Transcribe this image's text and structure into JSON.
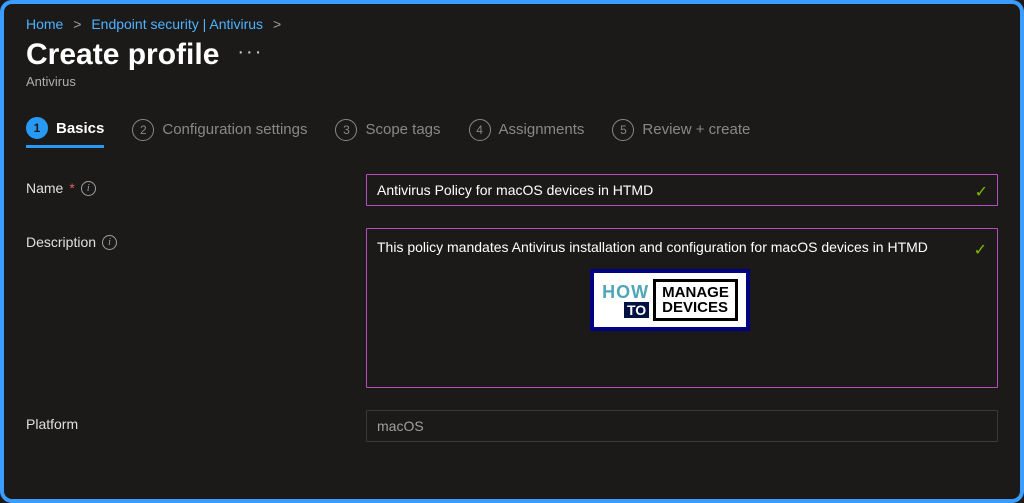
{
  "breadcrumb": {
    "home": "Home",
    "section": "Endpoint security | Antivirus"
  },
  "header": {
    "title": "Create profile",
    "subtitle": "Antivirus"
  },
  "tabs": [
    {
      "num": "1",
      "label": "Basics",
      "active": true
    },
    {
      "num": "2",
      "label": "Configuration settings",
      "active": false
    },
    {
      "num": "3",
      "label": "Scope tags",
      "active": false
    },
    {
      "num": "4",
      "label": "Assignments",
      "active": false
    },
    {
      "num": "5",
      "label": "Review + create",
      "active": false
    }
  ],
  "form": {
    "name_label": "Name",
    "name_value": "Antivirus Policy for macOS devices in HTMD",
    "desc_label": "Description",
    "desc_value": "This policy mandates Antivirus installation and configuration for macOS devices in HTMD",
    "platform_label": "Platform",
    "platform_value": "macOS"
  },
  "logo": {
    "how": "HOW",
    "to": "TO",
    "line1": "MANAGE",
    "line2": "DEVICES"
  }
}
